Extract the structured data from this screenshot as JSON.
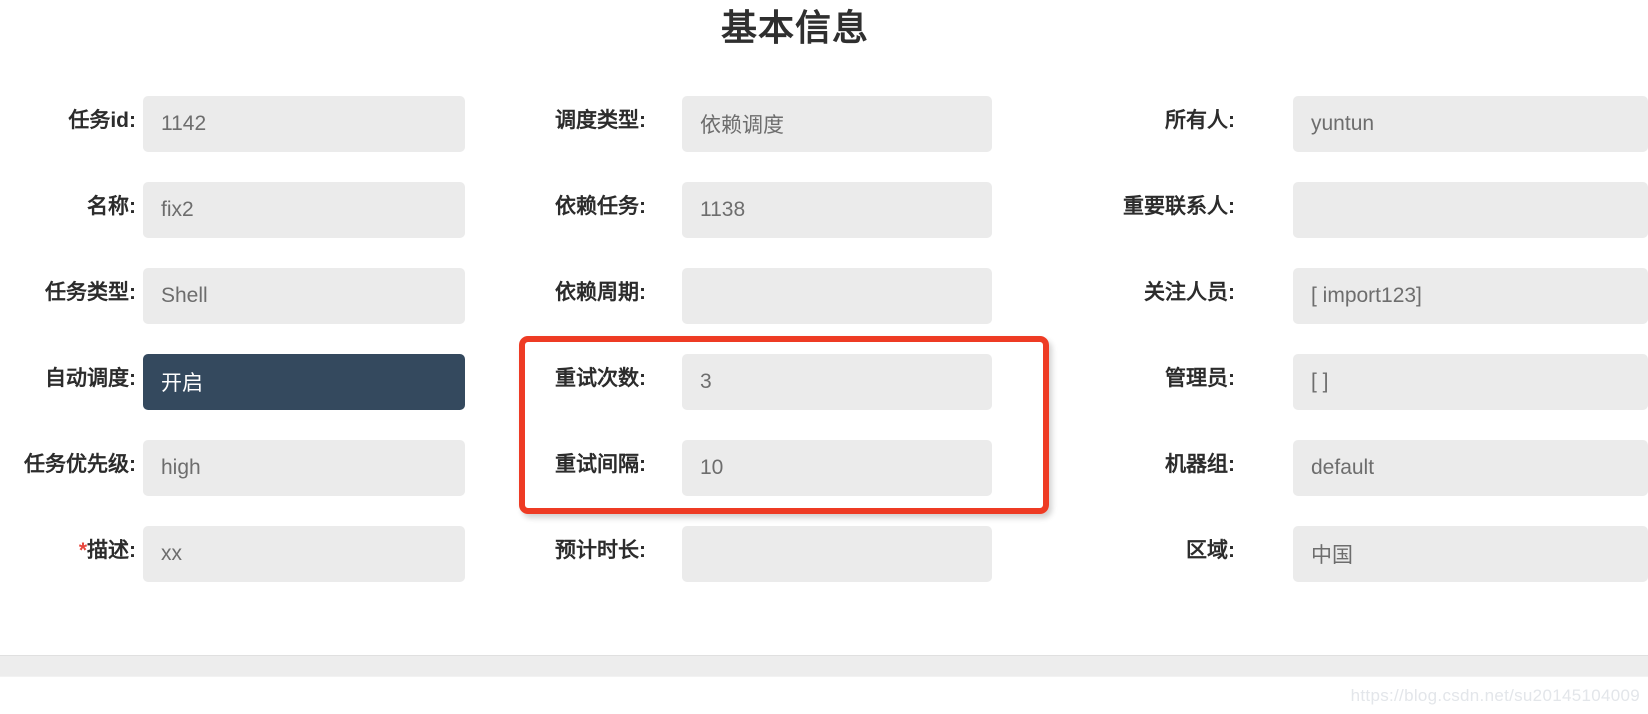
{
  "header": {
    "title": "基本信息"
  },
  "form": {
    "columns": [
      {
        "name": "left",
        "rows": [
          {
            "label": "任务id:",
            "value": "1142",
            "required": false,
            "style": "normal"
          },
          {
            "label": "名称:",
            "value": "fix2",
            "required": false,
            "style": "normal"
          },
          {
            "label": "任务类型:",
            "value": "Shell",
            "required": false,
            "style": "normal"
          },
          {
            "label": "自动调度:",
            "value": "开启",
            "required": false,
            "style": "toggle-on"
          },
          {
            "label": "任务优先级:",
            "value": "high",
            "required": false,
            "style": "normal"
          },
          {
            "label": "描述:",
            "value": "xx",
            "required": true,
            "style": "normal"
          }
        ]
      },
      {
        "name": "middle",
        "rows": [
          {
            "label": "调度类型:",
            "value": "依赖调度",
            "required": false,
            "style": "normal"
          },
          {
            "label": "依赖任务:",
            "value": "1138",
            "required": false,
            "style": "normal"
          },
          {
            "label": "依赖周期:",
            "value": "",
            "required": false,
            "style": "normal"
          },
          {
            "label": "重试次数:",
            "value": "3",
            "required": false,
            "style": "normal"
          },
          {
            "label": "重试间隔:",
            "value": "10",
            "required": false,
            "style": "normal"
          },
          {
            "label": "预计时长:",
            "value": "",
            "required": false,
            "style": "normal"
          }
        ]
      },
      {
        "name": "right",
        "rows": [
          {
            "label": "所有人:",
            "value": "yuntun",
            "required": false,
            "style": "normal"
          },
          {
            "label": "重要联系人:",
            "value": "",
            "required": false,
            "style": "normal"
          },
          {
            "label": "关注人员:",
            "value": "[ import123]",
            "required": false,
            "style": "normal"
          },
          {
            "label": "管理员:",
            "value": "[ ]",
            "required": false,
            "style": "normal"
          },
          {
            "label": "机器组:",
            "value": "default",
            "required": false,
            "style": "normal"
          },
          {
            "label": "区域:",
            "value": "中国",
            "required": false,
            "style": "normal"
          }
        ]
      }
    ]
  },
  "annotation": {
    "type": "red-rectangle-highlight",
    "color": "#ee3b24",
    "targets": [
      "重试次数",
      "重试间隔"
    ]
  },
  "watermark": {
    "text": "https://blog.csdn.net/su20145104009"
  },
  "colors": {
    "field_background": "#ebebeb",
    "field_text": "#6d6d6d",
    "label_text": "#2c2c2c",
    "toggle_on_background": "#34495e",
    "toggle_on_text": "#ffffff",
    "required_star": "#e8453c",
    "highlight_border": "#ee3b24",
    "bottom_bar": "#ededed"
  }
}
